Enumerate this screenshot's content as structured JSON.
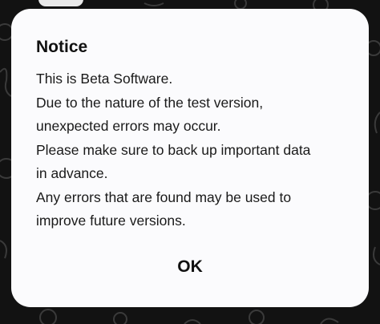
{
  "dialog": {
    "title": "Notice",
    "lines": [
      "This is Beta Software.",
      "Due to the nature of the test version,",
      "unexpected errors may occur.",
      "Please make sure to back up important data",
      "in advance.",
      "Any errors that are found may be used to",
      "improve future versions."
    ],
    "ok_label": "OK"
  },
  "colors": {
    "background": "#121212",
    "dialog_surface": "#fbfbfd",
    "text": "#111111"
  }
}
